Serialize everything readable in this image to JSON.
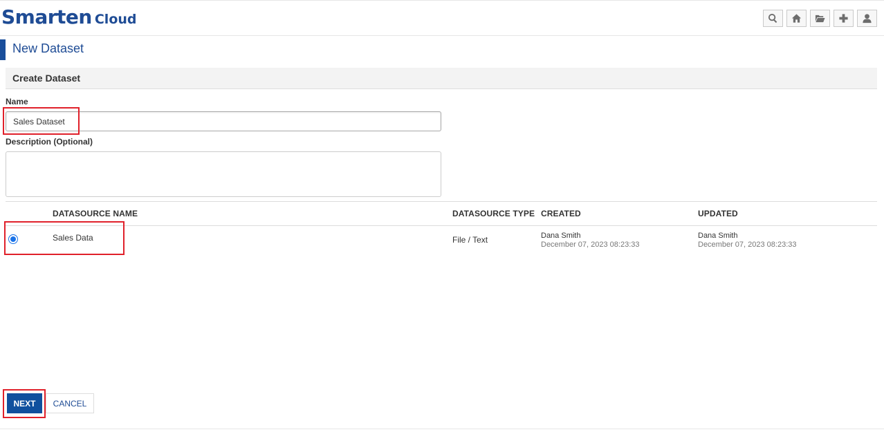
{
  "header": {
    "brand": "Smarten",
    "brand_sub": "Cloud",
    "actions": [
      {
        "name": "search-button",
        "icon": "search-icon"
      },
      {
        "name": "home-button",
        "icon": "home-icon"
      },
      {
        "name": "open-folder-button",
        "icon": "folder-open-icon"
      },
      {
        "name": "add-button",
        "icon": "plus-icon"
      },
      {
        "name": "user-button",
        "icon": "user-icon"
      }
    ]
  },
  "page": {
    "title": "New Dataset"
  },
  "form": {
    "section_title": "Create Dataset",
    "name_label": "Name",
    "name_value": "Sales Dataset",
    "description_label": "Description (Optional)",
    "description_value": ""
  },
  "table": {
    "columns": [
      "DATASOURCE NAME",
      "DATASOURCE TYPE",
      "CREATED",
      "UPDATED"
    ],
    "rows": [
      {
        "selected": true,
        "name": "Sales Data",
        "type": "File / Text",
        "created_by": "Dana Smith",
        "created_at": "December 07, 2023 08:23:33",
        "updated_by": "Dana Smith",
        "updated_at": "December 07, 2023 08:23:33"
      }
    ]
  },
  "footer": {
    "next_label": "NEXT",
    "cancel_label": "CANCEL"
  },
  "colors": {
    "brand": "#1f4c95",
    "primary_button": "#10509e",
    "highlight": "#e0202a"
  }
}
